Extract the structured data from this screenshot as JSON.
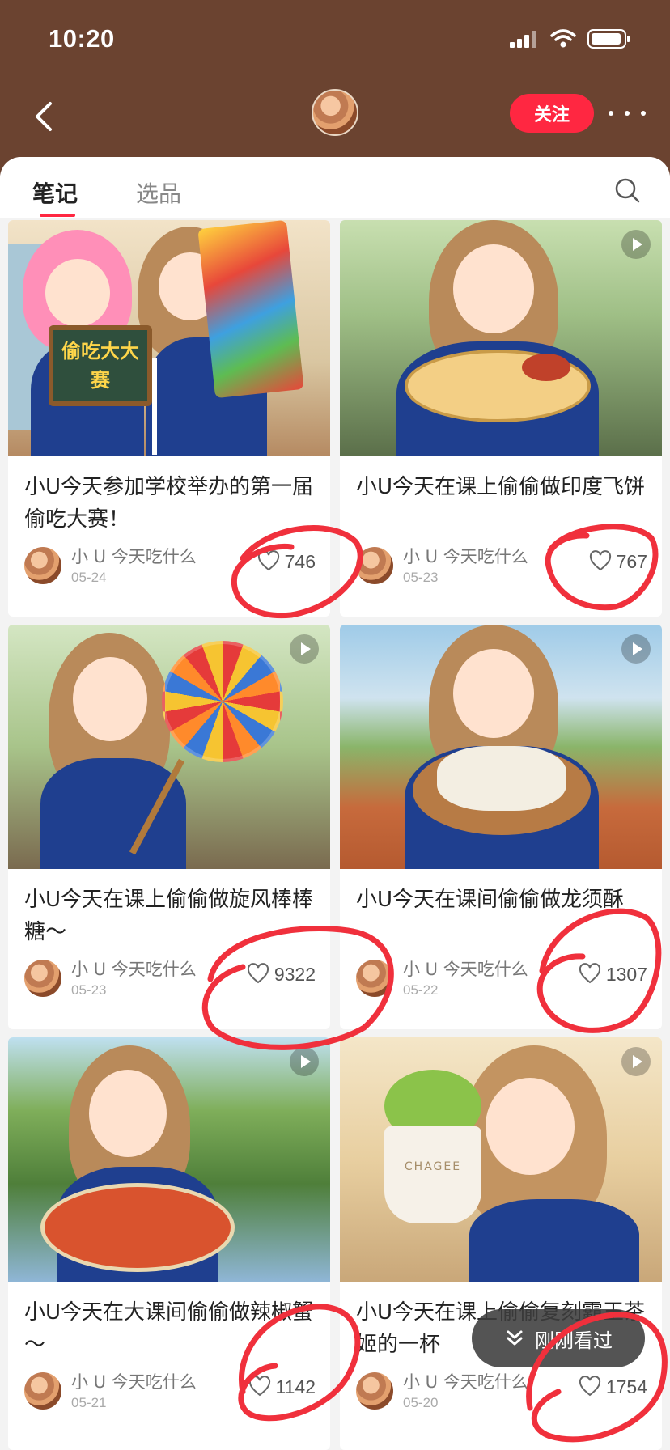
{
  "status": {
    "time": "10:20"
  },
  "nav": {
    "follow_label": "关注"
  },
  "tabs": [
    {
      "label": "笔记"
    },
    {
      "label": "选品"
    }
  ],
  "cards": [
    {
      "title": "小U今天参加学校举办的第一届偷吃大赛！",
      "author": "小 U 今天吃什么",
      "date": "05-24",
      "likes": "746",
      "sign_text": "偷吃大大赛"
    },
    {
      "title": "小U今天在课上偷偷做印度飞饼",
      "author": "小 U 今天吃什么",
      "date": "05-23",
      "likes": "767"
    },
    {
      "title": "小U今天在课上偷偷做旋风棒棒糖～",
      "author": "小 U 今天吃什么",
      "date": "05-23",
      "likes": "9322"
    },
    {
      "title": "小U今天在课间偷偷做龙须酥",
      "author": "小 U 今天吃什么",
      "date": "05-22",
      "likes": "1307"
    },
    {
      "title": "小U今天在大课间偷偷做辣椒蟹～",
      "author": "小 U 今天吃什么",
      "date": "05-21",
      "likes": "1142"
    },
    {
      "title": "小U今天在课上偷偷复刻霸王茶姬的一杯",
      "author": "小 U 今天吃什么",
      "date": "05-20",
      "likes": "1754",
      "cup_text": "CHAGEE"
    }
  ],
  "floating": {
    "label": "刚刚看过"
  },
  "colors": {
    "header_bg": "#6b4330",
    "accent": "#ff2741",
    "annotation": "#f0303c"
  }
}
